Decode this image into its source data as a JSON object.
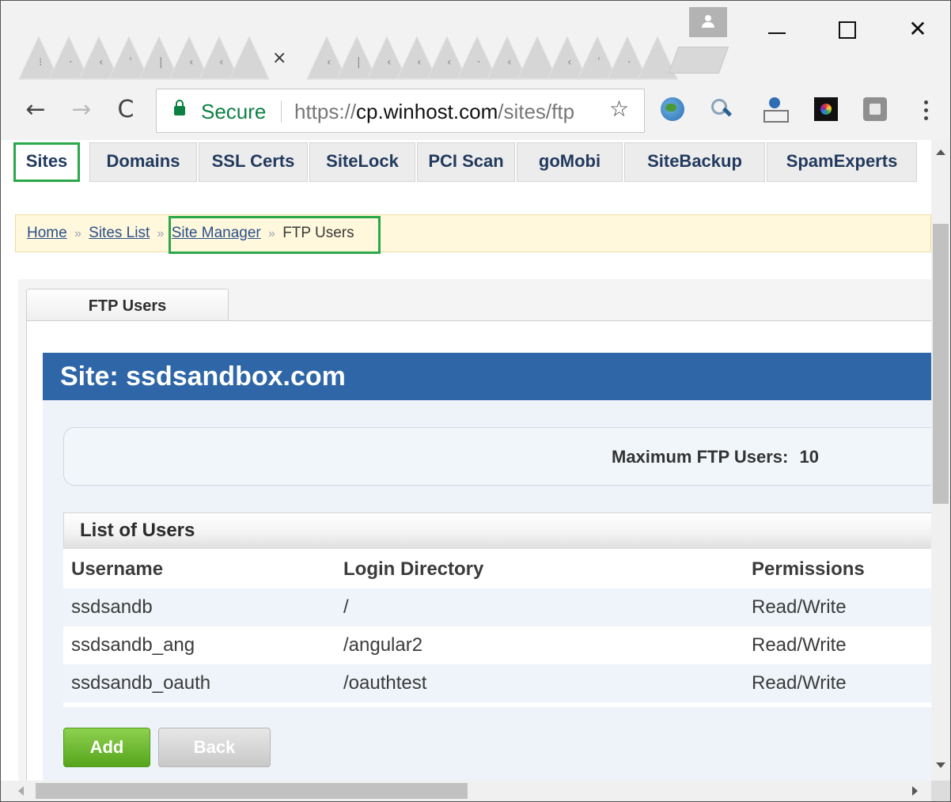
{
  "browser": {
    "active_tab_close": "×",
    "window_close": "✕",
    "nav": {
      "back": "←",
      "forward": "→",
      "reload": "C"
    },
    "omnibox": {
      "secure_label": "Secure",
      "url_scheme": "https://",
      "url_host": "cp.winhost.com",
      "url_path": "/sites/ftp",
      "star": "☆"
    },
    "extension_icons": [
      "globe-icon",
      "search-icon",
      "person-icon",
      "color-wheel-icon",
      "gray-square-icon"
    ]
  },
  "site_nav": {
    "tabs": [
      {
        "label": "Sites",
        "active": true
      },
      {
        "label": "Domains"
      },
      {
        "label": "SSL Certs"
      },
      {
        "label": "SiteLock"
      },
      {
        "label": "PCI Scan"
      },
      {
        "label": "goMobi"
      },
      {
        "label": "SiteBackup"
      },
      {
        "label": "SpamExperts"
      }
    ]
  },
  "breadcrumb": {
    "items": [
      "Home",
      "Sites List",
      "Site Manager"
    ],
    "separator": "»",
    "current": "FTP Users"
  },
  "panel": {
    "tab_label": "FTP Users",
    "site_title": "Site: ssdsandbox.com",
    "max_users_label": "Maximum FTP Users:",
    "max_users_value": "10"
  },
  "users": {
    "title": "List of Users",
    "columns": [
      "Username",
      "Login Directory",
      "Permissions"
    ],
    "rows": [
      {
        "username": "ssdsandb",
        "directory": "/",
        "permissions": "Read/Write"
      },
      {
        "username": "ssdsandb_ang",
        "directory": "/angular2",
        "permissions": "Read/Write"
      },
      {
        "username": "ssdsandb_oauth",
        "directory": "/oauthtest",
        "permissions": "Read/Write"
      }
    ]
  },
  "buttons": {
    "add": "Add",
    "back": "Back"
  },
  "colors": {
    "header_blue": "#2e66a8",
    "highlight_green": "#2aa84a",
    "add_green": "#55a51c",
    "secure_green": "#0b8043"
  }
}
